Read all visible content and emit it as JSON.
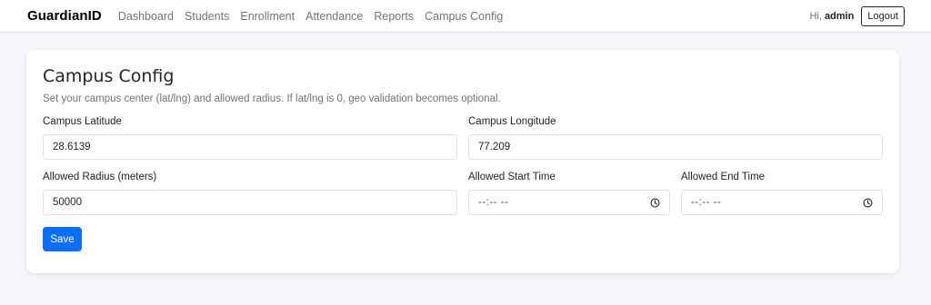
{
  "navbar": {
    "brand": "GuardianID",
    "links": [
      "Dashboard",
      "Students",
      "Enrollment",
      "Attendance",
      "Reports",
      "Campus Config"
    ],
    "greeting_prefix": "Hi, ",
    "username": "admin",
    "logout_label": "Logout"
  },
  "card": {
    "title": "Campus Config",
    "description": "Set your campus center (lat/lng) and allowed radius. If lat/lng is 0, geo validation becomes optional.",
    "latitude_label": "Campus Latitude",
    "latitude_value": "28.6139",
    "longitude_label": "Campus Longitude",
    "longitude_value": "77.209",
    "radius_label": "Allowed Radius (meters)",
    "radius_value": "50000",
    "start_time_label": "Allowed Start Time",
    "start_time_placeholder": "--:-- --",
    "end_time_label": "Allowed End Time",
    "end_time_placeholder": "--:-- --",
    "save_label": "Save"
  },
  "colors": {
    "primary": "#0d6efd",
    "background": "#f5f6f9",
    "muted_text": "#6c757d"
  },
  "icons": [
    "clock-icon"
  ]
}
